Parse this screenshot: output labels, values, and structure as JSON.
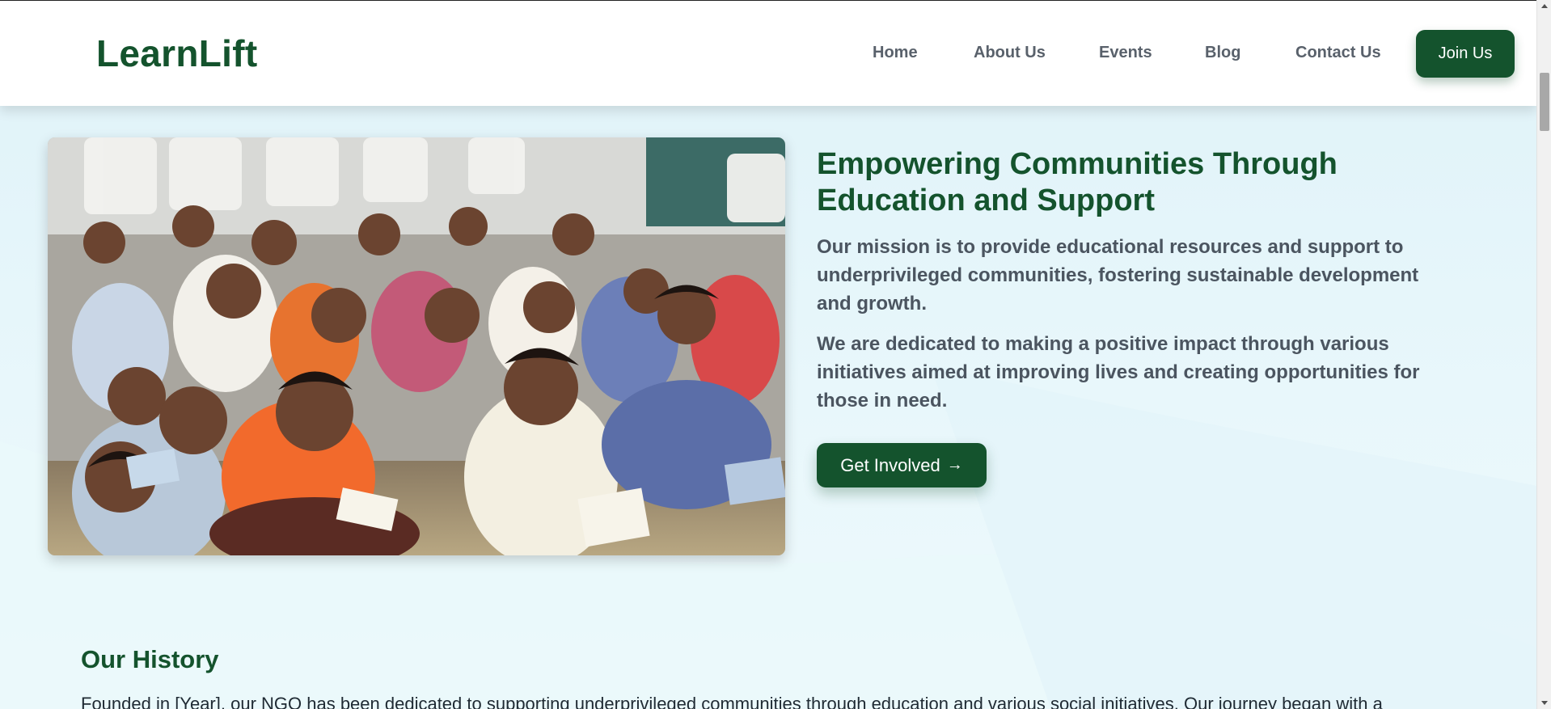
{
  "brand": {
    "name": "LearnLift",
    "color": "#14532d"
  },
  "nav": {
    "links": [
      {
        "label": "Home"
      },
      {
        "label": "About Us"
      },
      {
        "label": "Events"
      },
      {
        "label": "Blog"
      },
      {
        "label": "Contact Us"
      }
    ],
    "cta_label": "Join Us"
  },
  "hero": {
    "image_icon": "photo-children-classroom",
    "title": "Empowering Communities Through Education and Support",
    "paragraph_1": "Our mission is to provide educational resources and support to underprivileged communities, fostering sustainable development and growth.",
    "paragraph_2": "We are dedicated to making a positive impact through various initiatives aimed at improving lives and creating opportunities for those in need.",
    "cta_label": "Get Involved",
    "cta_icon": "arrow-right-icon"
  },
  "history": {
    "title": "Our History",
    "text": "Founded in [Year], our NGO has been dedicated to supporting underprivileged communities through education and various social initiatives. Our journey began with a"
  },
  "colors": {
    "primary": "#14532d",
    "page_background": "#e6f6fa",
    "nav_text": "#59616b",
    "body_text": "#4b5560"
  }
}
